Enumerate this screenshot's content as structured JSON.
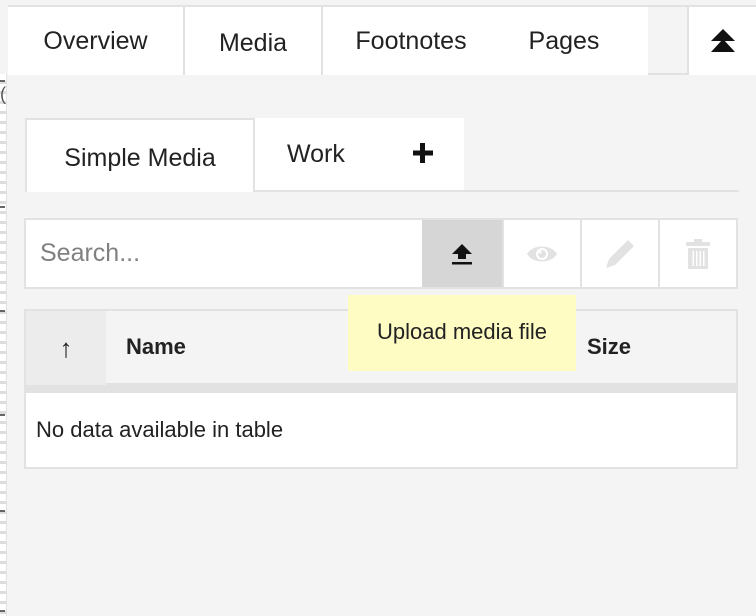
{
  "top_tabs": [
    {
      "label": "Overview",
      "active": false
    },
    {
      "label": "Media",
      "active": true
    },
    {
      "label": "Footnotes",
      "active": false
    },
    {
      "label": "Pages",
      "active": false
    }
  ],
  "collapse_button": {
    "icon": "double-chevron-up-icon"
  },
  "sub_tabs": [
    {
      "label": "Simple Media",
      "active": true
    },
    {
      "label": "Work",
      "active": false
    }
  ],
  "add_tab": {
    "icon": "plus-icon"
  },
  "toolbar": {
    "search_placeholder": "Search...",
    "search_value": "",
    "buttons": [
      {
        "name": "upload",
        "icon": "upload-icon",
        "enabled": true,
        "hovered": true
      },
      {
        "name": "view",
        "icon": "eye-icon",
        "enabled": false
      },
      {
        "name": "edit",
        "icon": "pencil-icon",
        "enabled": false
      },
      {
        "name": "delete",
        "icon": "trash-icon",
        "enabled": false
      }
    ]
  },
  "tooltip": {
    "text": "Upload media file"
  },
  "table": {
    "sort_indicator": "↑",
    "columns": [
      "Name",
      "Size"
    ],
    "rows": [],
    "empty_message": "No data available in table"
  },
  "ruler": {
    "glyph": "("
  }
}
